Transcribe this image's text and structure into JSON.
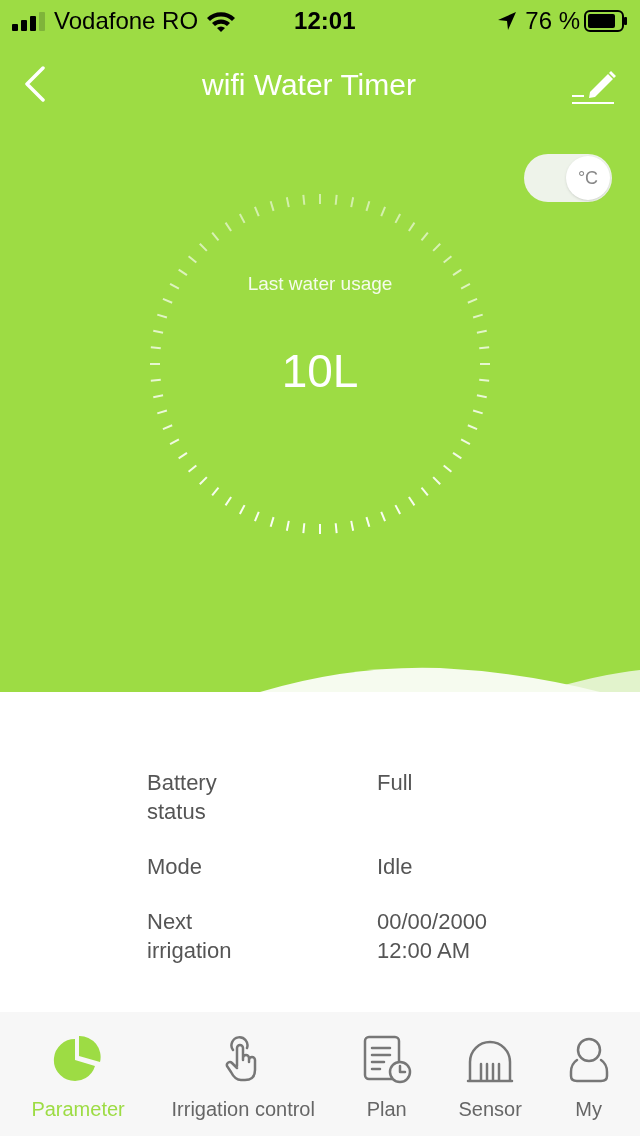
{
  "status_bar": {
    "carrier": "Vodafone RO",
    "time": "12:01",
    "battery": "76 %"
  },
  "header": {
    "title": "wifi Water Timer"
  },
  "unit_switch": {
    "label": "°C",
    "on": true
  },
  "usage": {
    "label": "Last water usage",
    "value": "10L"
  },
  "info": [
    {
      "label": "Battery status",
      "value": "Full"
    },
    {
      "label": "Mode",
      "value": "Idle"
    },
    {
      "label": "Next irrigation",
      "value": "00/00/2000 12:00 AM"
    }
  ],
  "tabs": [
    {
      "label": "Parameter",
      "kind": "chart",
      "selected": true
    },
    {
      "label": "Irrigation control",
      "kind": "hand",
      "selected": false
    },
    {
      "label": "Plan",
      "kind": "plan",
      "selected": false
    },
    {
      "label": "Sensor",
      "kind": "sensor",
      "selected": false
    },
    {
      "label": "My",
      "kind": "user",
      "selected": false
    }
  ]
}
